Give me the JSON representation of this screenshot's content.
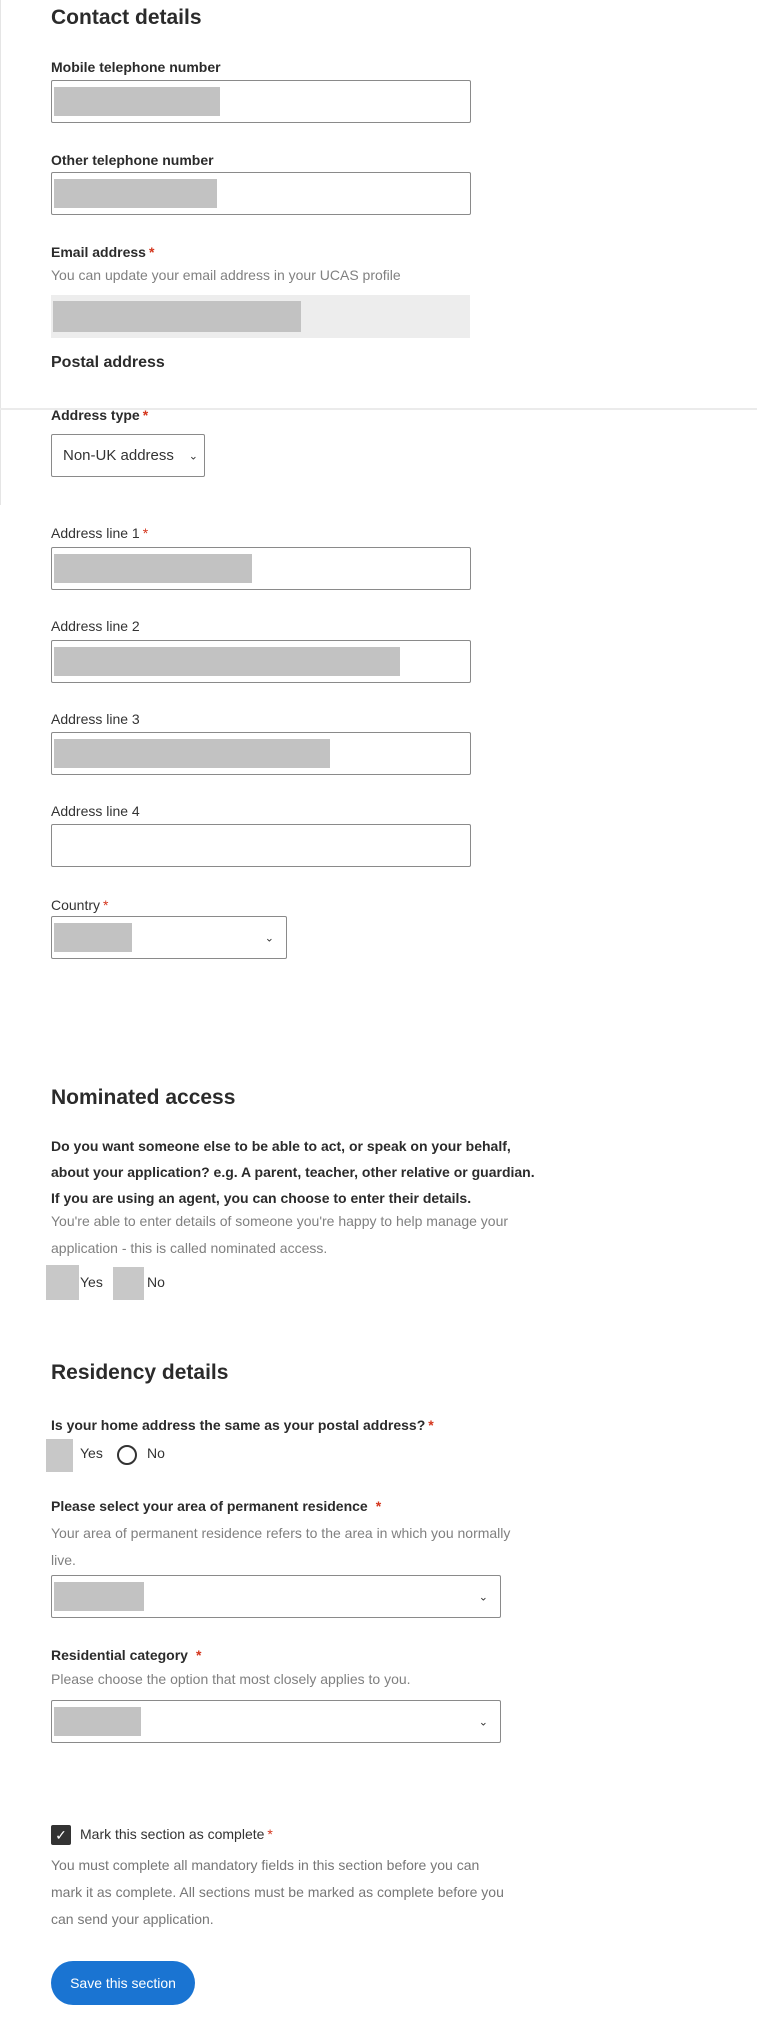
{
  "contact": {
    "heading": "Contact details",
    "mobile_label": "Mobile telephone number",
    "other_label": "Other telephone number",
    "email_label": "Email address",
    "email_hint": "You can update your email address in your UCAS profile",
    "required_mark": "*"
  },
  "postal": {
    "heading": "Postal address",
    "address_type_label": "Address type",
    "address_type_value": "Non-UK address",
    "line1_label": "Address line 1",
    "line2_label": "Address line 2",
    "line3_label": "Address line 3",
    "line4_label": "Address line 4",
    "country_label": "Country"
  },
  "nominated": {
    "heading": "Nominated access",
    "question_lines": [
      "Do you want someone else to be able to act, or speak on your behalf,",
      "about your application? e.g. A parent, teacher, other relative or guardian.",
      "If you are using an agent, you can choose to enter their details."
    ],
    "hint_lines": [
      "You're able to enter details of someone you're happy to help manage your",
      "application - this is called nominated access."
    ],
    "yes": "Yes",
    "no": "No"
  },
  "residency": {
    "heading": "Residency details",
    "same_address_question": "Is your home address the same as your postal address?",
    "yes": "Yes",
    "no": "No",
    "area_label": "Please select your area of permanent residence",
    "area_hint_lines": [
      "Your area of permanent residence refers to the area in which you normally",
      "live."
    ],
    "category_label": "Residential category",
    "category_hint": "Please choose the option that most closely applies to you."
  },
  "complete": {
    "checkbox_label": "Mark this section as complete",
    "checked": true,
    "info_lines": [
      "You must complete all mandatory fields in this section before you can",
      "mark it as complete. All sections must be marked as complete before you",
      "can send your application."
    ],
    "save_button": "Save this section"
  },
  "colors": {
    "accent": "#1a74d2",
    "required": "#d4351c",
    "redaction": "#c2c2c2"
  }
}
